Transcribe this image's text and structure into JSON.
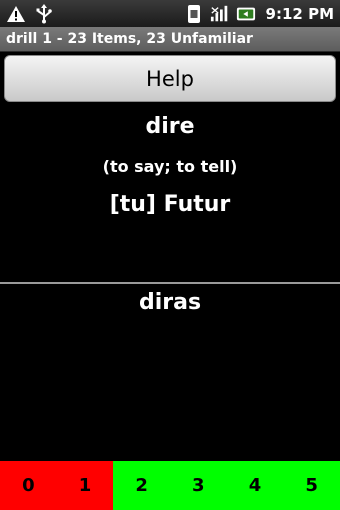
{
  "status_bar": {
    "time": "9:12 PM",
    "icons": [
      "warning-icon",
      "usb-icon",
      "sim-icon",
      "signal-icon",
      "battery-icon"
    ]
  },
  "title_bar": {
    "text": "drill 1 - 23 Items, 23 Unfamiliar"
  },
  "help_button": {
    "label": "Help"
  },
  "card": {
    "word": "dire",
    "gloss": "(to say; to tell)",
    "tense": "[tu] Futur",
    "answer": "diras"
  },
  "grades": [
    {
      "label": "0",
      "color": "#ff0000"
    },
    {
      "label": "1",
      "color": "#ff0000"
    },
    {
      "label": "2",
      "color": "#00ff00"
    },
    {
      "label": "3",
      "color": "#00ff00"
    },
    {
      "label": "4",
      "color": "#00ff00"
    },
    {
      "label": "5",
      "color": "#00ff00"
    }
  ]
}
